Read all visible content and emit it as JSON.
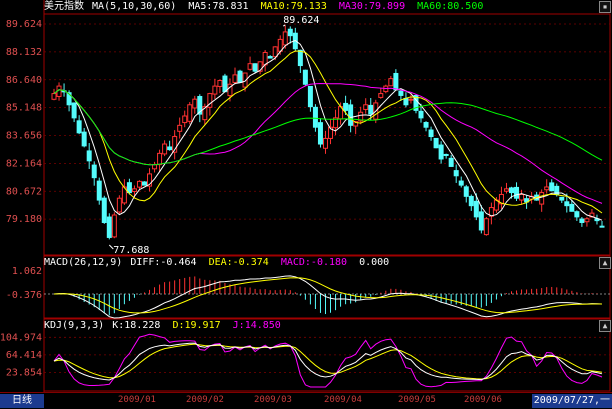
{
  "colors": {
    "up": "#ff3232",
    "down": "#54fcfc",
    "ma5": "#ffffff",
    "ma10": "#ffff00",
    "ma30": "#ff00ff",
    "ma60": "#00ff00",
    "grid": "#7a0000",
    "axis_text": "#e05050",
    "panel_border": "#a00000",
    "date_bg": "#1c3b8f"
  },
  "main": {
    "title": "美元指数",
    "ma_params": "MA(5,10,30,60)",
    "ma5": "MA5:78.831",
    "ma10": "MA10:79.133",
    "ma30": "MA30:79.899",
    "ma60": "MA60:80.500",
    "y_labels": [
      "89.624",
      "88.132",
      "86.640",
      "85.148",
      "83.656",
      "82.164",
      "80.672",
      "79.180"
    ],
    "high_label": "89.624",
    "low_label": "77.688"
  },
  "macd": {
    "params": "MACD(26,12,9)",
    "diff": "DIFF:-0.464",
    "dea": "DEA:-0.374",
    "macd": "MACD:-0.180",
    "zero": "0.000",
    "y_labels": [
      "1.062",
      "-0.376"
    ]
  },
  "kdj": {
    "params": "KDJ(9,3,3)",
    "k": "K:18.228",
    "d": "D:19.917",
    "j": "J:14.850",
    "y_labels": [
      "104.974",
      "64.414",
      "23.854"
    ]
  },
  "footer": {
    "tab": "日线",
    "dates": [
      "2009/01",
      "2009/02",
      "2009/03",
      "2009/04",
      "2009/05",
      "2009/06"
    ],
    "cursor_date": "2009/07/27,一"
  },
  "chart_data": [
    {
      "type": "candlestick",
      "title": "美元指数",
      "high": 89.624,
      "low": 77.688,
      "ylim": [
        77.688,
        89.624
      ],
      "y_ticks": [
        89.624,
        88.132,
        86.64,
        85.148,
        83.656,
        82.164,
        80.672,
        79.18
      ],
      "close_series": [
        85.9,
        86.3,
        86.0,
        85.3,
        84.6,
        83.8,
        83.1,
        82.3,
        81.4,
        80.2,
        79.0,
        78.2,
        79.4,
        80.3,
        80.9,
        80.6,
        80.8,
        81.2,
        81.0,
        81.6,
        82.1,
        82.7,
        83.2,
        82.9,
        83.6,
        84.2,
        84.7,
        85.3,
        85.6,
        84.8,
        85.2,
        85.9,
        86.3,
        86.6,
        86.0,
        86.4,
        86.9,
        86.5,
        87.0,
        87.5,
        87.1,
        87.6,
        88.1,
        87.8,
        88.4,
        88.8,
        89.2,
        89.0,
        88.3,
        87.4,
        86.4,
        85.2,
        84.1,
        83.2,
        83.5,
        84.1,
        84.6,
        85.2,
        85.0,
        84.2,
        84.4,
        84.9,
        85.3,
        84.8,
        85.4,
        85.9,
        86.3,
        86.7,
        86.1,
        85.8,
        85.3,
        85.6,
        85.0,
        84.6,
        84.1,
        83.6,
        83.0,
        82.4,
        82.6,
        82.0,
        81.5,
        81.0,
        80.4,
        79.9,
        79.3,
        78.6,
        79.2,
        79.8,
        80.2,
        80.5,
        80.8,
        80.6,
        80.3,
        80.5,
        80.1,
        80.4,
        80.2,
        80.6,
        80.9,
        80.7,
        80.5,
        80.2,
        79.9,
        79.6,
        79.3,
        79.0,
        79.2,
        79.5,
        79.1,
        78.8
      ]
    },
    {
      "type": "line",
      "title": "MACD(26,12,9)",
      "series": [
        {
          "name": "DIFF",
          "last": -0.464
        },
        {
          "name": "DEA",
          "last": -0.374
        },
        {
          "name": "MACD",
          "last": -0.18
        }
      ],
      "y_ticks": [
        1.062,
        -0.376
      ]
    },
    {
      "type": "line",
      "title": "KDJ(9,3,3)",
      "series": [
        {
          "name": "K",
          "last": 18.228
        },
        {
          "name": "D",
          "last": 19.917
        },
        {
          "name": "J",
          "last": 14.85
        }
      ],
      "y_ticks": [
        104.974,
        64.414,
        23.854
      ]
    }
  ]
}
